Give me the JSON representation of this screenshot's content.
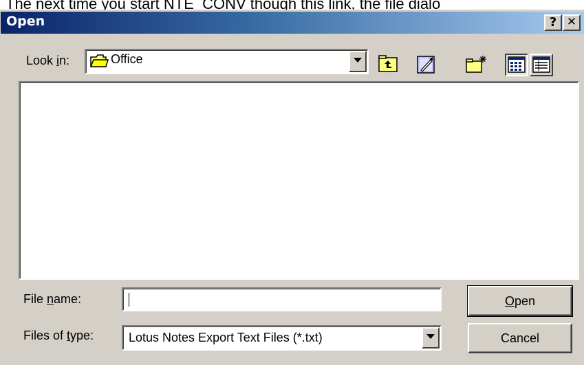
{
  "background_text": "The next time you start NTE_CONV though this link, the file dialo",
  "titlebar": {
    "title": "Open",
    "help_label": "?",
    "close_label": "✕"
  },
  "look_in": {
    "label_pre": "Look ",
    "label_accel": "i",
    "label_post": "n:",
    "value": "Office"
  },
  "toolbar": {
    "up_icon": "up-one-level-icon",
    "favorites_icon": "desktop-shortcut-icon",
    "new_folder_icon": "new-folder-icon",
    "list_view_icon": "list-view-icon",
    "details_view_icon": "details-view-icon"
  },
  "file_list": {
    "items": []
  },
  "file_name": {
    "label_pre": "File ",
    "label_accel": "n",
    "label_post": "ame:",
    "value": ""
  },
  "files_of_type": {
    "label_pre": "Files of ",
    "label_accel": "t",
    "label_post": "ype:",
    "value": "Lotus Notes Export Text Files (*.txt)"
  },
  "buttons": {
    "open_accel": "O",
    "open_rest": "pen",
    "cancel": "Cancel"
  },
  "colors": {
    "face": "#d4d0c8",
    "title_start": "#0a246a",
    "title_end": "#a6caf0",
    "highlight": "#ffffff",
    "shadow": "#808080"
  }
}
